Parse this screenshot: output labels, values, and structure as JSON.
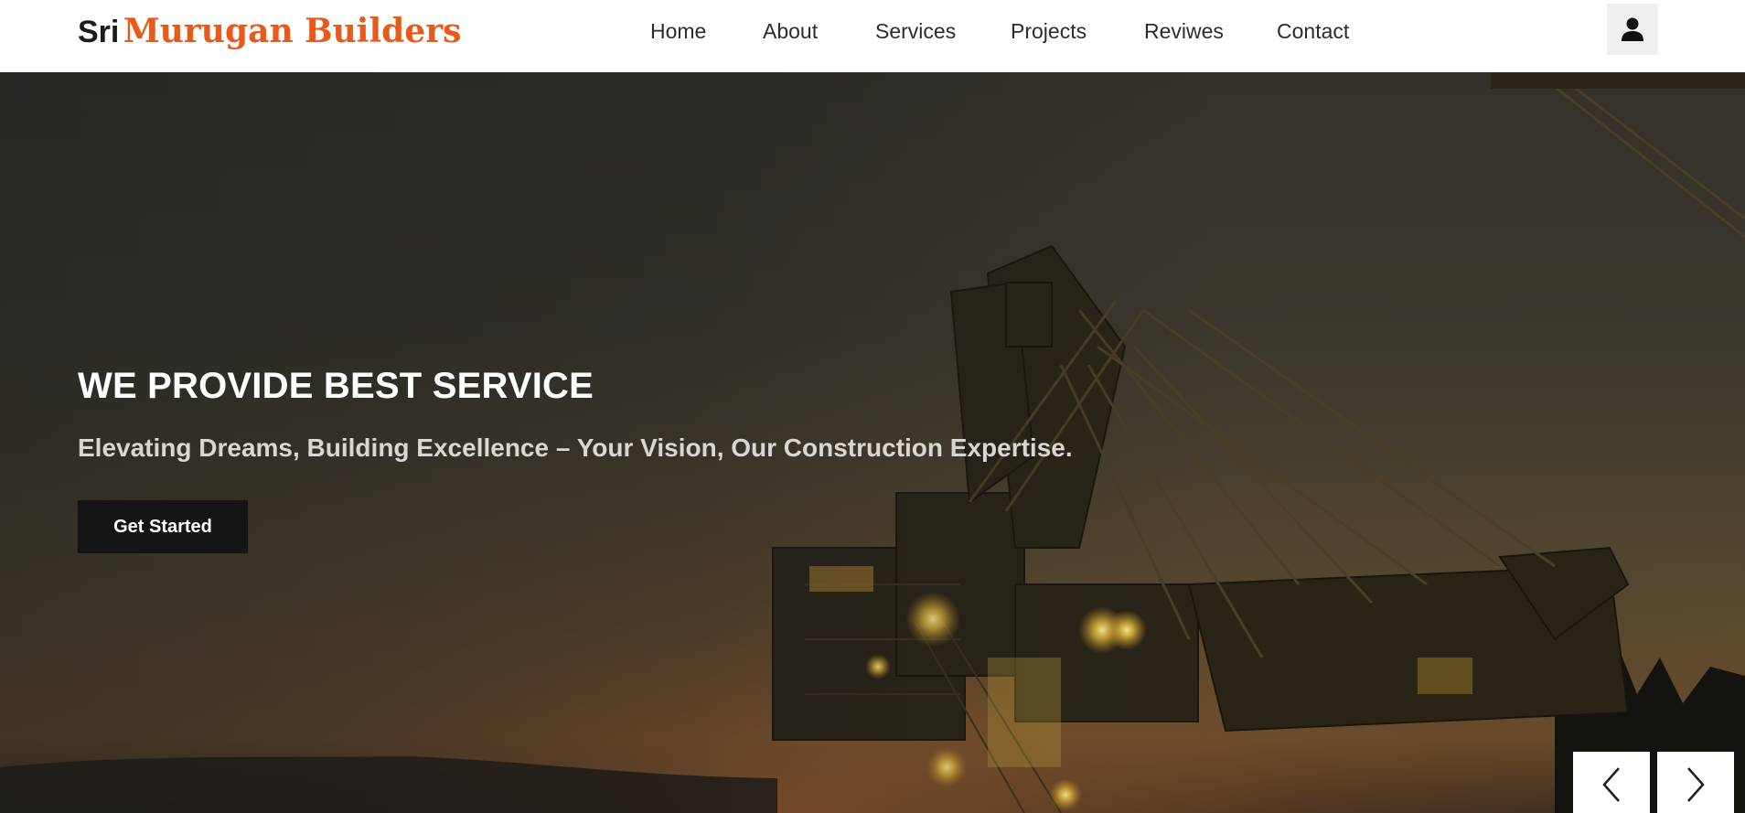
{
  "brand": {
    "first": "Sri",
    "rest": "Murugan Builders"
  },
  "nav": {
    "items": [
      {
        "label": "Home"
      },
      {
        "label": "About"
      },
      {
        "label": "Services"
      },
      {
        "label": "Projects"
      },
      {
        "label": "Reviwes"
      },
      {
        "label": "Contact"
      }
    ],
    "user_icon": "user-icon"
  },
  "hero": {
    "title": "WE PROVIDE BEST SERVICE",
    "subtitle": "Elevating Dreams, Building Excellence – Your Vision, Our Construction Expertise.",
    "cta_label": "Get Started",
    "prev_icon": "chevron-left-icon",
    "next_icon": "chevron-right-icon"
  },
  "colors": {
    "accent": "#e85a1a",
    "brand_dark": "#1b1b1b",
    "cta_bg": "#151515",
    "nav_text": "#2b2b2b"
  }
}
